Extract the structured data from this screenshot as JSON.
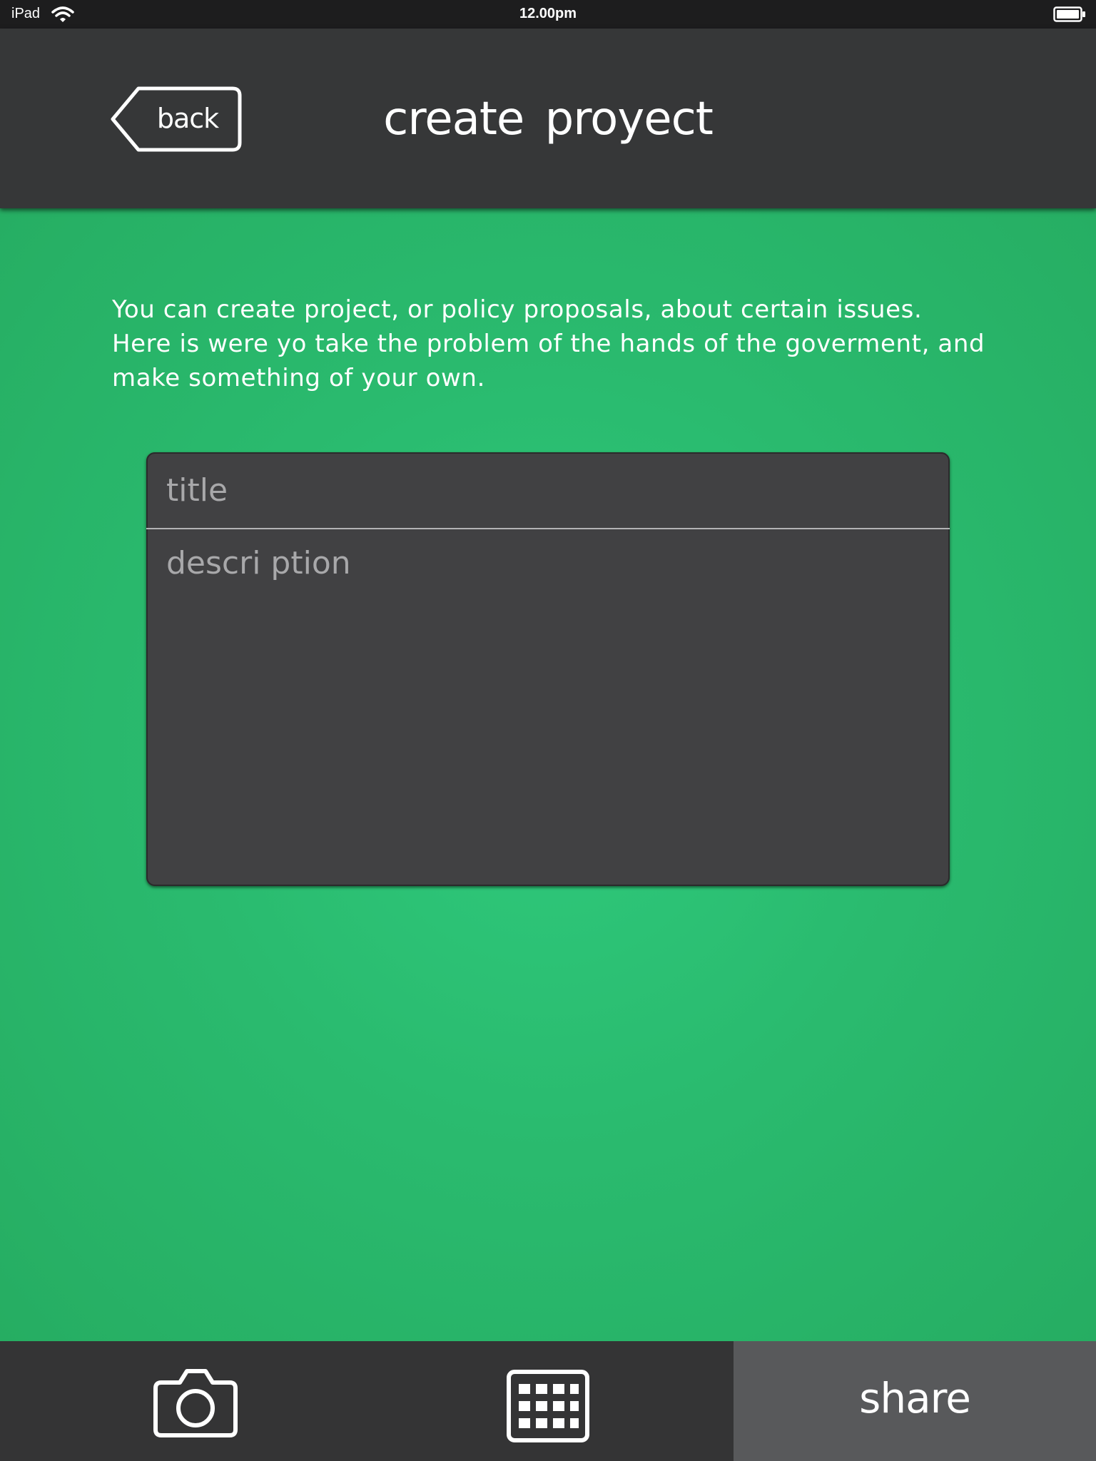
{
  "status_bar": {
    "device": "iPad",
    "time": "12.00pm",
    "icons": [
      "wifi-icon",
      "battery-icon"
    ]
  },
  "nav": {
    "back_label": "back",
    "title": "create proyect"
  },
  "intro": {
    "lines": [
      "You can create project, or policy proposals, about certain issues.",
      "Here is were yo take the problem of the hands of the goverment, and",
      "make something of your own."
    ]
  },
  "form": {
    "title_placeholder": "title",
    "title_value": "",
    "description_placeholder": "descri ption",
    "description_value": ""
  },
  "toolbar": {
    "camera_icon": "camera-icon",
    "grid_icon": "grid-icon",
    "share_label": "share"
  },
  "colors": {
    "green_background": "#2bb56a",
    "dark_bar": "#363738",
    "status_bar": "#1d1d1e",
    "card": "#414143",
    "share_button": "#58595b",
    "text": "#ffffff",
    "placeholder": "#a8a8aa"
  }
}
